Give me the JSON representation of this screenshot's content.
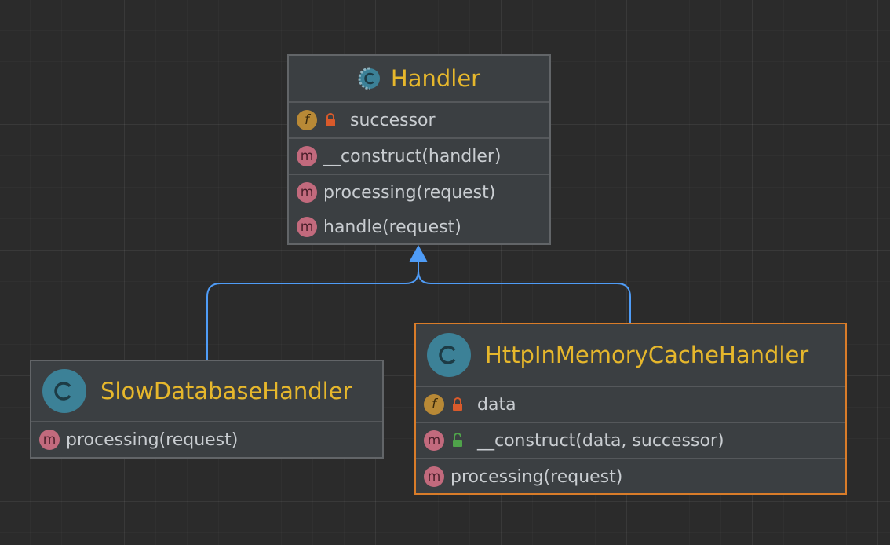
{
  "diagram": {
    "background_color": "#2b2b2b",
    "edge_color": "#4f9cf7",
    "title_color": "#e6b72c",
    "classes": {
      "handler": {
        "name": "Handler",
        "icon": "abstract-class-icon",
        "fields": [
          {
            "badge": "f",
            "visibility": "private",
            "label": "successor"
          }
        ],
        "constructors": [
          {
            "badge": "m",
            "label": "__construct(handler)"
          }
        ],
        "methods": [
          {
            "badge": "m",
            "label": "processing(request)"
          },
          {
            "badge": "m",
            "label": "handle(request)"
          }
        ]
      },
      "slow_database_handler": {
        "name": "SlowDatabaseHandler",
        "icon": "class-icon",
        "methods": [
          {
            "badge": "m",
            "label": "processing(request)"
          }
        ]
      },
      "http_in_memory_cache_handler": {
        "name": "HttpInMemoryCacheHandler",
        "icon": "class-icon",
        "selected": true,
        "fields": [
          {
            "badge": "f",
            "visibility": "private",
            "label": "data"
          }
        ],
        "constructors": [
          {
            "badge": "m",
            "visibility": "public",
            "label": "__construct(data, successor)"
          }
        ],
        "methods": [
          {
            "badge": "m",
            "label": "processing(request)"
          }
        ]
      }
    },
    "edges": [
      {
        "from": "SlowDatabaseHandler",
        "to": "Handler",
        "type": "generalization"
      },
      {
        "from": "HttpInMemoryCacheHandler",
        "to": "Handler",
        "type": "generalization"
      }
    ]
  }
}
